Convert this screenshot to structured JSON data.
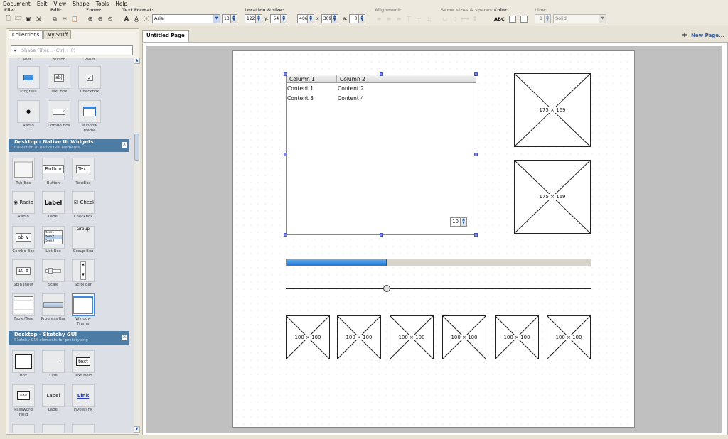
{
  "menu": [
    "Document",
    "Edit",
    "View",
    "Shape",
    "Tools",
    "Help"
  ],
  "toolbar": {
    "file_label": "File:",
    "edit_label": "Edit:",
    "zoom_label": "Zoom:",
    "text_format_label": "Text Format:",
    "font_name": "Arial",
    "font_size": "13",
    "location_label": "Location & size:",
    "x_prefix": "x:",
    "x": "122",
    "y_prefix": "y:",
    "y": "54",
    "w": "406",
    "times": "x",
    "h": "369",
    "angle_prefix": "a:",
    "angle": "0",
    "alignment_label": "Alignment:",
    "same_sizes_label": "Same sizes & spaces:",
    "color_label": "Color:",
    "color_text": "ABC",
    "line_label": "Line:",
    "line_width": "1",
    "line_style": "Solid"
  },
  "left_panel": {
    "tabs": [
      "Collections",
      "My Stuff"
    ],
    "filter_placeholder": "Shape Filter... (Ctrl + F)",
    "top_partial_labels": [
      "Label",
      "Button",
      "Panel"
    ],
    "top_items": [
      {
        "label": "Progress"
      },
      {
        "label": "Text Box",
        "glyph": "ab|"
      },
      {
        "label": "Checkbox",
        "glyph": "✓"
      },
      {
        "label": "Radio",
        "glyph": "●"
      },
      {
        "label": "Combo Box"
      },
      {
        "label": "Window Frame"
      }
    ],
    "section_native": {
      "title": "Desktop - Native UI Widgets",
      "subtitle": "Collection of native GUI elements"
    },
    "native_items": [
      {
        "label": "Tab Box"
      },
      {
        "label": "Button",
        "glyph": "Button"
      },
      {
        "label": "TextBox",
        "glyph": "Text"
      },
      {
        "label": "Radio",
        "glyph": "Radio"
      },
      {
        "label": "Label",
        "glyph": "Label"
      },
      {
        "label": "Checkbox",
        "glyph": "Check"
      },
      {
        "label": "Combo Box",
        "glyph": "ab"
      },
      {
        "label": "List Box",
        "list": [
          "Item1",
          "Item2",
          "Item3"
        ]
      },
      {
        "label": "Group Box",
        "glyph": "Group"
      },
      {
        "label": "Spin Input",
        "glyph": "10"
      },
      {
        "label": "Scale"
      },
      {
        "label": "Scrollbar"
      },
      {
        "label": "Table/Tree"
      },
      {
        "label": "Progress Bar"
      },
      {
        "label": "Window Frame"
      }
    ],
    "section_sketchy": {
      "title": "Desktop - Sketchy GUI",
      "subtitle": "Sketchy GUI elements for prototyping"
    },
    "sketchy_items": [
      {
        "label": "Box"
      },
      {
        "label": "Line"
      },
      {
        "label": "Text Field",
        "glyph": "text"
      },
      {
        "label": "Password Field",
        "glyph": "***"
      },
      {
        "label": "Label",
        "glyph": "Label"
      },
      {
        "label": "Hyperlink",
        "glyph": "Link"
      }
    ]
  },
  "page_tab": "Untitled Page",
  "new_page": "New Page...",
  "canvas": {
    "table": {
      "columns": [
        "Column 1",
        "Column 2"
      ],
      "rows": [
        [
          "Content 1",
          "Content 2"
        ],
        [
          "Content 3",
          "Content 4"
        ]
      ],
      "spin_value": "10"
    },
    "big_images": [
      "175 × 169",
      "175 × 169"
    ],
    "progress_fraction": 0.33,
    "slider_fraction": 0.33,
    "small_images": [
      "100 × 100",
      "100 × 100",
      "100 × 100",
      "100 × 100",
      "100 × 100",
      "100 × 100"
    ]
  }
}
